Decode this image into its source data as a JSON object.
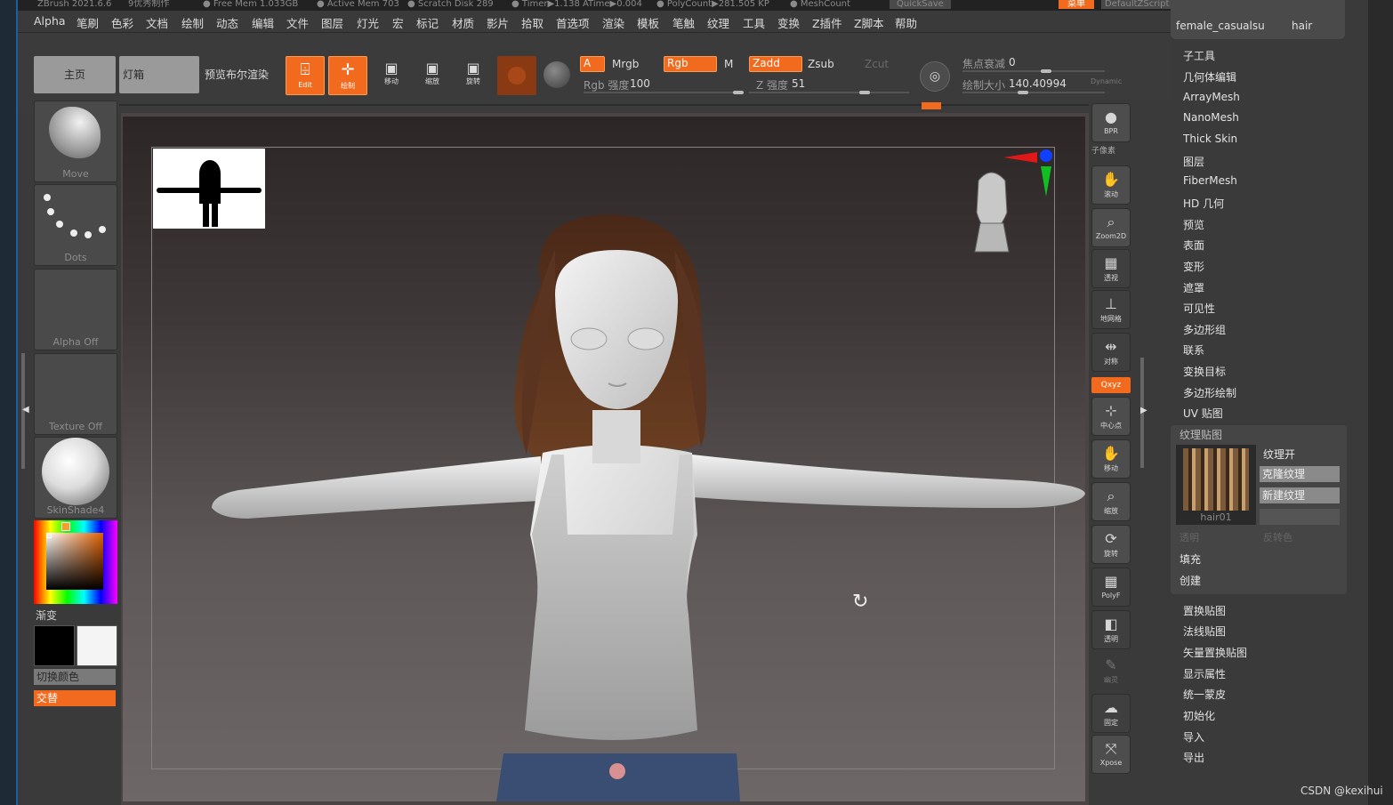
{
  "titlebar": {
    "app": "ZBrush 2021.6.6",
    "doc": "9优秀制作",
    "free_mem": "● Free Mem 1.033GB",
    "active_mem": "● Active Mem 703",
    "scratch": "● Scratch Disk 289",
    "timer": "● Timer▶1.138 ATime▶0.004",
    "polycount": "● PolyCount▶281.505 KP",
    "meshcount": "● MeshCount",
    "quicksave": "QuickSave",
    "menu_btn": "菜单",
    "script": "DefaultZScript"
  },
  "menu": [
    "Alpha",
    "笔刷",
    "色彩",
    "文档",
    "绘制",
    "动态",
    "编辑",
    "文件",
    "图层",
    "灯光",
    "宏",
    "标记",
    "材质",
    "影片",
    "拾取",
    "首选项",
    "渲染",
    "模板",
    "笔触",
    "纹理",
    "工具",
    "变换",
    "Z插件",
    "Z脚本",
    "帮助"
  ],
  "toolbar": {
    "home": "主页",
    "lightbox": "灯箱",
    "bpr": "预览布尔渲染",
    "edit": "Edit",
    "draw": "绘制",
    "move": "移动",
    "scale": "缩放",
    "rotate": "旋转",
    "a": "A",
    "mrgb": "Mrgb",
    "rgb": "Rgb",
    "m": "M",
    "rgb_intensity_label": "Rgb 强度",
    "rgb_intensity": "100",
    "zadd": "Zadd",
    "zsub": "Zsub",
    "zcut": "Zcut",
    "z_intensity_label": "Z 强度",
    "z_intensity": "51",
    "focal_label": "焦点衰减",
    "focal": "0",
    "draw_size_label": "绘制大小",
    "draw_size": "140.40994",
    "dynamic": "Dynamic"
  },
  "leftshelf": {
    "brush": "Move",
    "stroke": "Dots",
    "alpha": "Alpha Off",
    "texture": "Texture Off",
    "material": "SkinShade4",
    "gradient": "渐变",
    "switch_color": "切换颜色",
    "alternate": "交替"
  },
  "rightshelf": [
    "BPR",
    "子像素",
    "滚动",
    "Zoom2D",
    "透视",
    "地网格",
    "对称",
    "Qxyz",
    "中心点",
    "移动",
    "缩放",
    "旋转",
    "PolyF",
    "透明",
    "幽灵",
    "固定",
    "Xpose"
  ],
  "palette": {
    "tool_name": "female_casualsu",
    "tool2_name": "hair",
    "items_top": [
      "子工具",
      "几何体编辑",
      "ArrayMesh",
      "NanoMesh",
      "Thick Skin",
      "图层",
      "FiberMesh",
      "HD 几何",
      "预览",
      "表面",
      "变形",
      "遮罩",
      "可见性",
      "多边形组",
      "联系",
      "变换目标",
      "多边形绘制",
      "UV 贴图"
    ],
    "texture_map_title": "纹理贴图",
    "texture_on": "纹理开",
    "clone_texture": "克隆纹理",
    "new_texture": "新建纹理",
    "texture_name": "hair01",
    "transparent": "透明",
    "invert": "反转色",
    "fill": "填充",
    "create": "创建",
    "items_bottom": [
      "置换贴图",
      "法线贴图",
      "矢量置换贴图",
      "显示属性",
      "统一蒙皮",
      "初始化",
      "导入",
      "导出"
    ]
  },
  "watermark": "CSDN @kexihui"
}
